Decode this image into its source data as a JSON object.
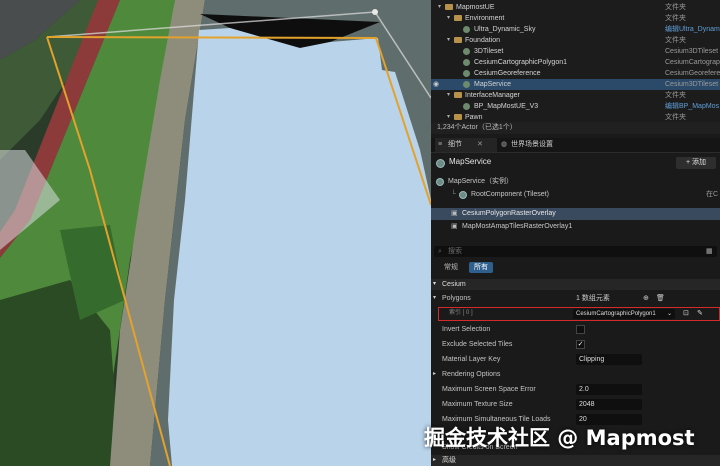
{
  "outliner": {
    "rows": [
      {
        "name": "MapmostUE",
        "type": "文件夹",
        "kind": "folder",
        "indent": 0
      },
      {
        "name": "Environment",
        "type": "文件夹",
        "kind": "folder",
        "indent": 1
      },
      {
        "name": "Ultra_Dynamic_Sky",
        "type": "编辑Ultra_Dynam",
        "kind": "actor",
        "indent": 2,
        "link": true
      },
      {
        "name": "Foundation",
        "type": "文件夹",
        "kind": "folder",
        "indent": 1
      },
      {
        "name": "3DTileset",
        "type": "Cesium3DTileset",
        "kind": "actor",
        "indent": 2
      },
      {
        "name": "CesiumCartographicPolygon1",
        "type": "CesiumCartograp",
        "kind": "actor",
        "indent": 2
      },
      {
        "name": "CesiumGeoreference",
        "type": "CesiumGeorefere",
        "kind": "actor",
        "indent": 2
      },
      {
        "name": "MapService",
        "type": "Cesium3DTileset",
        "kind": "actor",
        "indent": 2,
        "selected": true
      },
      {
        "name": "InterfaceManager",
        "type": "文件夹",
        "kind": "folder",
        "indent": 1
      },
      {
        "name": "BP_MapMostUE_V3",
        "type": "编辑BP_MapMos",
        "kind": "actor",
        "indent": 2,
        "link": true
      },
      {
        "name": "Pawn",
        "type": "文件夹",
        "kind": "folder",
        "indent": 1
      }
    ],
    "status": "1,234个Actor（已选1个）"
  },
  "tabs": {
    "details": "细节",
    "world_settings": "世界场景设置"
  },
  "details": {
    "actor_name": "MapService",
    "add_label": "+ 添加",
    "instance_label": "MapService（实例）",
    "root_component": "RootComponent (Tileset)",
    "root_component_suffix": "在C",
    "components": [
      "CesiumPolygonRasterOverlay",
      "MapMostAmapTilesRasterOverlay1"
    ],
    "search_placeholder": "搜索",
    "filter_general": "常规",
    "filter_all": "所有"
  },
  "properties": {
    "section_cesium": "Cesium",
    "polygons_label": "Polygons",
    "polygons_count": "1 数组元素",
    "index_label": "索引 [ 0 ]",
    "index_value": "CesiumCartographicPolygon1",
    "invert_selection": "Invert Selection",
    "exclude_selected_tiles": "Exclude Selected Tiles",
    "exclude_checked": "✓",
    "material_layer_key": "Material Layer Key",
    "material_layer_value": "Clipping",
    "rendering_options": "Rendering Options",
    "max_sse": "Maximum Screen Space Error",
    "max_sse_value": "2.0",
    "max_texture": "Maximum Texture Size",
    "max_texture_value": "2048",
    "max_tile_loads": "Maximum Simultaneous Tile Loads",
    "max_tile_loads_value": "20",
    "show_credits": "Show Credits on Screen",
    "section_bottom": "高级"
  },
  "watermark": "掘金技术社区 @ Mapmost",
  "colors": {
    "selection": "#2b4a69",
    "polygon_outline": "#e3a22c",
    "clip_fill": "#b9d3ea",
    "highlight_red": "#d42a2a"
  }
}
